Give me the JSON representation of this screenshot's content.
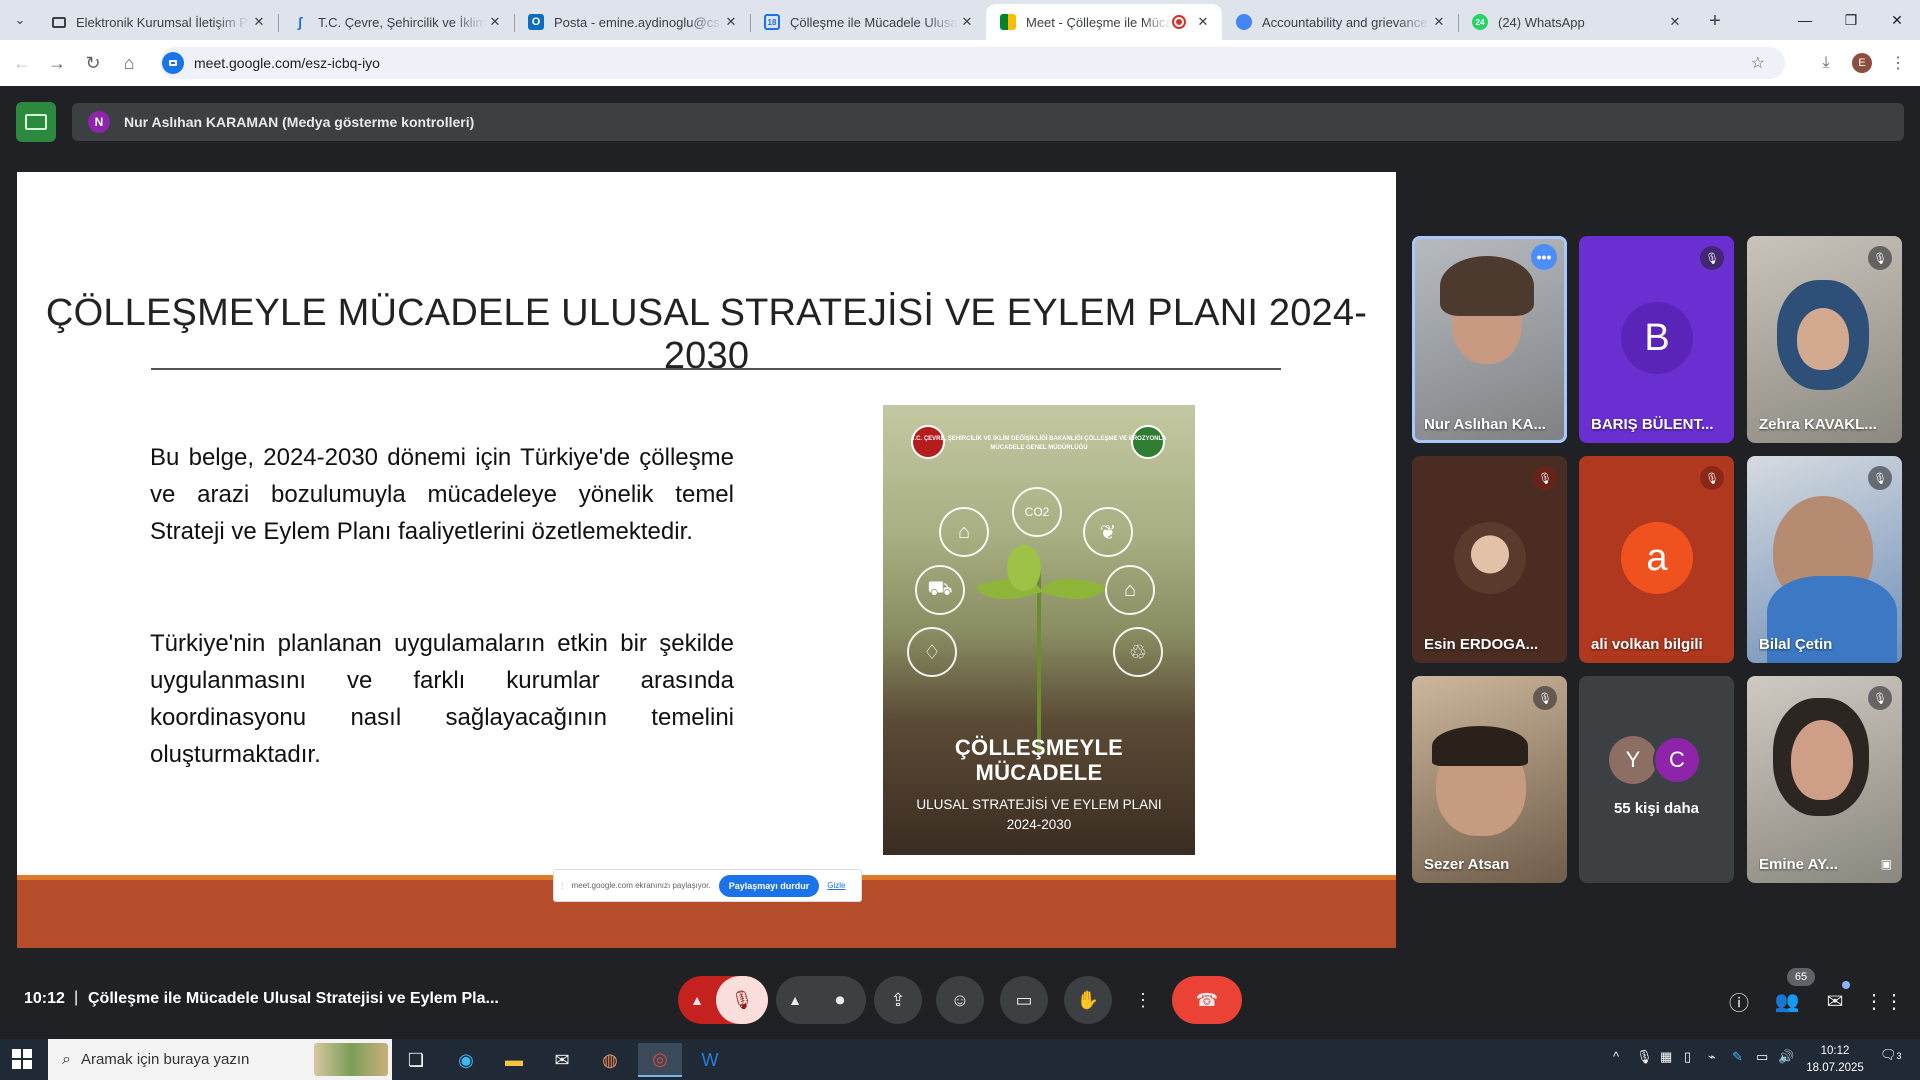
{
  "browser": {
    "tabs": [
      {
        "title": "Elektronik Kurumsal İletişim Pla",
        "icon": "monitor-icon",
        "color": "#3c4043"
      },
      {
        "title": "T.C. Çevre, Şehircilik ve İklim De",
        "icon": "ministry-logo-icon",
        "color": "#1a73e8"
      },
      {
        "title": "Posta - emine.aydinoglu@csb.g",
        "icon": "outlook-icon",
        "color": "#0f6cbd"
      },
      {
        "title": "Çölleşme ile Mücadele Ulusal S",
        "icon": "document-icon",
        "color": "#1a73e8"
      },
      {
        "title": "Meet - Çölleşme ile Mücade",
        "icon": "meet-icon",
        "color": "#00897b"
      },
      {
        "title": "Accountability and grievance m",
        "icon": "globe-icon",
        "color": "#4285f4"
      },
      {
        "title": "(24) WhatsApp",
        "icon": "whatsapp-icon",
        "color": "#25d366",
        "badge": "24"
      }
    ],
    "active_tab_index": 4,
    "url": "meet.google.com/esz-icbq-iyo",
    "profile_initial": "E"
  },
  "meet": {
    "presenter_initial": "N",
    "presenter_label": "Nur Aslıhan KARAMAN (Medya gösterme kontrolleri)",
    "slide": {
      "title": "ÇÖLLEŞMEYLE MÜCADELE ULUSAL STRATEJİSİ VE EYLEM PLANI 2024-2030",
      "paragraph1": "Bu belge, 2024-2030 dönemi için Türkiye'de çölleşme ve arazi bozulumuyla mücadeleye yönelik temel Strateji ve Eylem Planı faaliyetlerini özetlemektedir.",
      "paragraph2": "Türkiye'nin planlanan uygulamaların etkin bir şekilde uygulanmasını ve farklı kurumlar arasında koordinasyonu nasıl sağlayacağının temelini oluşturmaktadır.",
      "cover": {
        "header": "T.C. ÇEVRE, ŞEHİRCİLİK VE İKLİM DEĞİŞİKLİĞİ BAKANLIĞI ÇÖLLEŞME VE EROZYONLA MÜCADELE GENEL MÜDÜRLÜĞÜ",
        "title_line1": "ÇÖLLEŞMEYLE",
        "title_line2": "MÜCADELE",
        "subtitle_line1": "ULUSAL STRATEJİSİ VE EYLEM PLANI",
        "subtitle_line2": "2024-2030",
        "co2_label": "CO2"
      }
    },
    "share_bar": {
      "text": "meet.google.com ekranınızı paylaşıyor.",
      "stop_label": "Paylaşmayı durdur",
      "hide_label": "Gizle"
    },
    "participants": [
      {
        "name": "Nur Aslıhan KA...",
        "type": "video",
        "muted": false
      },
      {
        "name": "BARIŞ BÜLENT...",
        "type": "avatar",
        "initial": "B",
        "bg": "#6a2fd1",
        "muted": true
      },
      {
        "name": "Zehra KAVAKL...",
        "type": "video",
        "muted": true
      },
      {
        "name": "Esin ERDOGA...",
        "type": "photo",
        "muted": true
      },
      {
        "name": "ali volkan bilgili",
        "type": "avatar",
        "initial": "a",
        "bg": "#f0521f",
        "muted": true
      },
      {
        "name": "Bilal Çetin",
        "type": "video",
        "muted": true
      },
      {
        "name": "Sezer Atsan",
        "type": "video",
        "muted": true
      },
      {
        "name": "55 kişi daha",
        "type": "more",
        "initials": [
          "Y",
          "C"
        ]
      },
      {
        "name": "Emine AY...",
        "type": "video",
        "muted": true
      }
    ],
    "time": "10:12",
    "separator": "|",
    "meeting_title": "Çölleşme ile Mücadele Ulusal Stratejisi ve Eylem Pla...",
    "people_count": "65"
  },
  "taskbar": {
    "search_placeholder": "Aramak için buraya yazın",
    "clock_time": "10:12",
    "clock_date": "18.07.2025",
    "notification_count": "3"
  }
}
